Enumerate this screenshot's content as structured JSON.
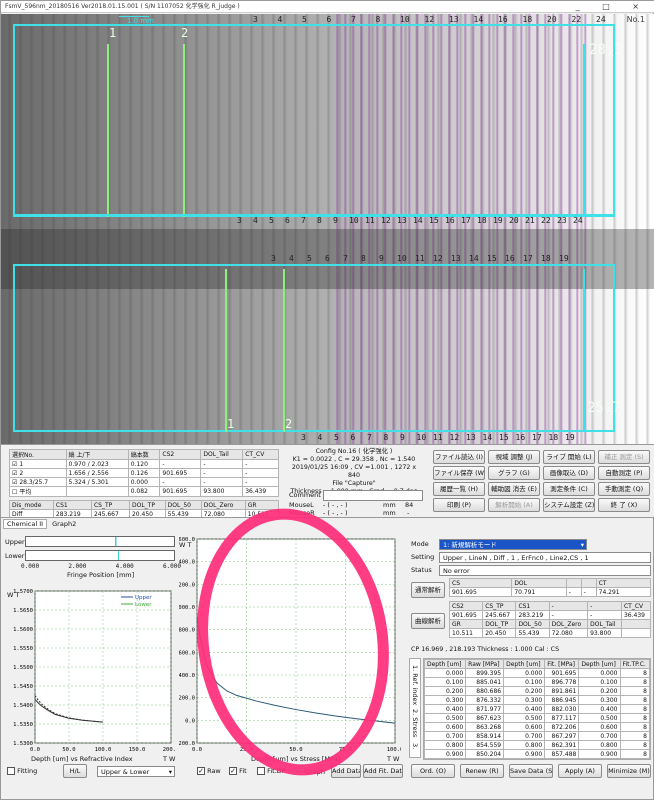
{
  "window": {
    "title": "FsmV_596nm_20180516 Ver2018.01.15.001  ( S/N 1107052  化学強化 R_judge )",
    "controls": [
      "_",
      "□",
      "×"
    ]
  },
  "image_view": {
    "scale_label": "1.0 mm",
    "corner_label": "No.1",
    "upper_value": "28.3",
    "lower_value": "25.7",
    "upper_fringe_numbers_top": [
      "1",
      "2",
      "3",
      "4",
      "5",
      "6",
      "7",
      "8",
      "10",
      "12",
      "13",
      "14",
      "16",
      "18",
      "20",
      "22",
      "24"
    ],
    "upper_fringe_numbers_bottom": [
      "3",
      "4",
      "5",
      "6",
      "7",
      "8",
      "9",
      "10",
      "11",
      "12",
      "13",
      "14",
      "15",
      "16",
      "17",
      "18",
      "19",
      "20",
      "21",
      "22",
      "23",
      "24"
    ],
    "lower_fringe_numbers_top": [
      "1",
      "2",
      "3",
      "4",
      "5",
      "6",
      "7",
      "8",
      "9",
      "10",
      "11",
      "12",
      "13",
      "14",
      "15",
      "16",
      "17",
      "18",
      "19"
    ],
    "lower_fringe_numbers_bottom": [
      "1",
      "2",
      "3",
      "4",
      "5",
      "6",
      "7",
      "8",
      "9",
      "10",
      "11",
      "12",
      "13",
      "14",
      "15",
      "16",
      "17",
      "18",
      "19"
    ]
  },
  "measure_table": {
    "headers": [
      "選択No.",
      "縞 上/下",
      "縞本数",
      "CS2",
      "DOL_Tail",
      "CT_CV"
    ],
    "rows": [
      {
        "check": "☑",
        "no": "1",
        "fringe": "0.970 / 2.023",
        "count": "0.120",
        "cs2": "-",
        "dol_tail": "-",
        "ct_cv": "-"
      },
      {
        "check": "☑",
        "no": "2",
        "fringe": "1.656 / 2.556",
        "count": "0.126",
        "cs2": "901.695",
        "dol_tail": "-",
        "ct_cv": "-"
      },
      {
        "check": "☑",
        "no": "28.3/25.7",
        "fringe": "5.324 / 5.301",
        "count": "0.000",
        "cs2": "-",
        "dol_tail": "-",
        "ct_cv": "-"
      },
      {
        "check": "☐",
        "no": "平均",
        "fringe": "",
        "count": "0.082",
        "cs2": "901.695",
        "dol_tail": "93.800",
        "ct_cv": "36.439"
      }
    ],
    "headers2": [
      "Dis_mode",
      "CS1",
      "CS_TP",
      "DOL_TP",
      "DOL_50",
      "DOL_Zero",
      "GR"
    ],
    "row2": [
      "Diff",
      "283.219",
      "245.667",
      "20.450",
      "55.439",
      "72.080",
      "10.511"
    ]
  },
  "config_info": {
    "line1": "Config No.16 ( 化学強化 )",
    "line2": "K1 = 0.0022 , C = 29.358 , Nc = 1.540",
    "line3": "2019/01/25 16:09 , CV =1.001 , 1272 x 840",
    "line4": "File  \"Capture\"",
    "line5": "Thickness = 1.000 mm , Grad = 0.7 deg"
  },
  "comment_area": {
    "comment_label": "Comment",
    "mousel_label": "MouseL",
    "mouser_label": "MouseR",
    "mousel_value": "- ( - , - )",
    "mouser_value": "- ( - , - )",
    "unit": "mm",
    "level": "84",
    "level_unit": "-"
  },
  "buttons_right": [
    [
      "ファイル読込 (I)",
      "視域 調整 (J)",
      "ライブ 開始 (L)",
      "補正 測定 (S)"
    ],
    [
      "ファイル保存 (W)",
      "グラフ (G)",
      "画像取込 (D)",
      "自動測定 (P)"
    ],
    [
      "履歴一覧 (H)",
      "輔助図 消去 (E)",
      "測定条件 (C)",
      "手動測定 (Q)"
    ],
    [
      "印刷 (P)",
      "解析開始 (A)",
      "システム設定 (Z)",
      "終 了 (X)"
    ]
  ],
  "panel": {
    "tabs": [
      "Chemical II",
      "Graph2"
    ],
    "fringe_bar": {
      "upper_label": "Upper",
      "lower_label": "Lower",
      "ticks": [
        "0.000",
        "2.000",
        "4.000",
        "6.000"
      ],
      "xlabel": "Fringe Position [mm]"
    },
    "left_plot": {
      "y_ticks": [
        "1.5700",
        "1.5650",
        "1.5600",
        "1.5550",
        "1.5500",
        "1.5450",
        "1.5400",
        "1.5350",
        "1.5300"
      ],
      "x_ticks": [
        "0.0",
        "50.0",
        "100.0",
        "150.0",
        "200.0"
      ],
      "xlabel": "Depth [um] vs Refractive Index",
      "legend_upper": "Upper",
      "legend_lower": "Lower",
      "wt_label": "W T",
      "tw_label": "T W",
      "fitting_label": "Fitting",
      "hl_button": "H/L",
      "select_value": "Upper & Lower"
    },
    "right_plot": {
      "y_ticks": [
        "1600.0",
        "1400.0",
        "1200.0",
        "1000.0",
        "800.0",
        "600.0",
        "400.0",
        "200.0",
        "0.0",
        "-200.0"
      ],
      "x_ticks": [
        "0.0",
        "25.0",
        "50.0",
        "75.0",
        "100.0"
      ],
      "xlabel": "Depth [um] vs Stress [MPa]",
      "wt_label": "W T",
      "tw_label": "T W",
      "raw_label": "Raw",
      "fit_label": "Fit",
      "fitdp_label": "Fit.DP",
      "graph_label": "Graph",
      "add_data": "Add Data",
      "add_fit_data": "Add Fit. Data"
    },
    "mode": {
      "mode_label": "Mode",
      "mode_value": "1: 新規解析モード",
      "setting_label": "Setting",
      "setting_value": "Upper , LineN , Diff , 1 , ErFnc0 , Line2,CS , 1",
      "status_label": "Status",
      "status_value": "No error"
    },
    "upper_block": {
      "button": "通常解析",
      "headers": [
        "CS",
        "DOL",
        "",
        "",
        "CT"
      ],
      "values": [
        "901.695",
        "70.791",
        "-",
        "-",
        "74.291"
      ]
    },
    "lower_block": {
      "button": "曲線解析",
      "headers1": [
        "CS2",
        "CS_TP",
        "CS1",
        "-",
        "-",
        "CT_CV"
      ],
      "values1": [
        "901.695",
        "245.667",
        "283.219",
        "-",
        "-",
        "36.439"
      ],
      "headers2": [
        "GR",
        "DOL_TP",
        "DOL_50",
        "DOL_Zero",
        "DOL_Tail"
      ],
      "values2": [
        "10.511",
        "20.450",
        "55.439",
        "72.080",
        "93.800"
      ]
    },
    "cp_line": "CP  16.969 , 218.193     Thickness : 1.000    Cal : CS",
    "data_table": {
      "side_tabs": [
        "1. Ref. index",
        "2. Stress",
        "3."
      ],
      "headers": [
        "Depth [um]",
        "Raw [MPa]",
        "Depth [um]",
        "Fit. [MPa]",
        "Depth [um]",
        "Fit.TP.C."
      ],
      "rows": [
        [
          "0.000",
          "899.395",
          "0.000",
          "901.695",
          "0.000",
          "8"
        ],
        [
          "0.100",
          "885.041",
          "0.100",
          "896.778",
          "0.100",
          "8"
        ],
        [
          "0.200",
          "880.686",
          "0.200",
          "891.861",
          "0.200",
          "8"
        ],
        [
          "0.300",
          "876.332",
          "0.300",
          "886.945",
          "0.300",
          "8"
        ],
        [
          "0.400",
          "871.977",
          "0.400",
          "882.030",
          "0.400",
          "8"
        ],
        [
          "0.500",
          "867.623",
          "0.500",
          "877.117",
          "0.500",
          "8"
        ],
        [
          "0.600",
          "863.268",
          "0.600",
          "872.206",
          "0.600",
          "8"
        ],
        [
          "0.700",
          "858.914",
          "0.700",
          "867.297",
          "0.700",
          "8"
        ],
        [
          "0.800",
          "854.559",
          "0.800",
          "862.391",
          "0.800",
          "8"
        ],
        [
          "0.900",
          "850.204",
          "0.900",
          "857.488",
          "0.900",
          "8"
        ],
        [
          "1.000",
          "845.850",
          "1.000",
          "852.589",
          "1.000",
          "8"
        ]
      ]
    },
    "bottom_buttons": [
      "Ord. (O)",
      "Renew (R)",
      "Save Data (S)",
      "Apply (A)",
      "Minimize (M)"
    ]
  },
  "chart_data": [
    {
      "type": "line",
      "title": "",
      "xlabel": "Depth [um] vs Refractive Index",
      "ylabel": "",
      "xlim": [
        0,
        200
      ],
      "ylim": [
        1.53,
        1.57
      ],
      "series": [
        {
          "name": "Upper",
          "x": [
            0,
            5,
            10,
            20,
            30,
            50,
            70,
            100
          ],
          "y": [
            1.5415,
            1.5405,
            1.5397,
            1.5385,
            1.5375,
            1.5365,
            1.536,
            1.5355
          ]
        },
        {
          "name": "Lower",
          "x": [
            0,
            5,
            10,
            20,
            30,
            50,
            70,
            100
          ],
          "y": [
            1.5425,
            1.5412,
            1.5402,
            1.5388,
            1.5377,
            1.5366,
            1.536,
            1.5355
          ]
        }
      ]
    },
    {
      "type": "line",
      "title": "",
      "xlabel": "Depth [um] vs Stress [MPa]",
      "ylabel": "",
      "xlim": [
        0,
        100
      ],
      "ylim": [
        -200,
        1600
      ],
      "series": [
        {
          "x": [
            0,
            2,
            5,
            10,
            15,
            20,
            30,
            40,
            50,
            60,
            70,
            80,
            90,
            100
          ],
          "y": [
            900,
            700,
            480,
            330,
            260,
            220,
            170,
            130,
            95,
            65,
            38,
            15,
            -5,
            -25
          ]
        }
      ]
    }
  ]
}
